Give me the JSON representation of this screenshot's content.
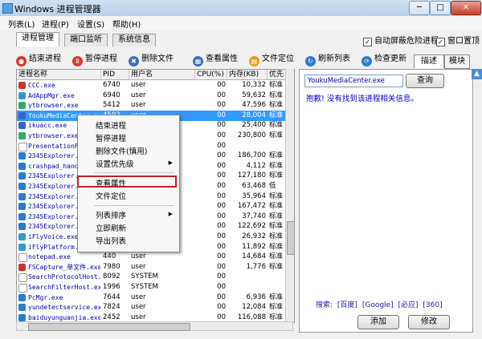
{
  "window": {
    "title": "Windows 进程管理器",
    "min": "─",
    "max": "□",
    "close": "✕"
  },
  "menubar": [
    "列表(L)",
    "进程(P)",
    "设置(S)",
    "帮助(H)"
  ],
  "tabs": [
    "进程管理",
    "端口监听",
    "系统信息"
  ],
  "options": {
    "auto_block": "自动屏蔽危险进程",
    "on_top": "窗口置顶",
    "auto_block_checked": true,
    "on_top_checked": true,
    "check_mark": "✓"
  },
  "toolbar": [
    {
      "label": "结束进程",
      "icon": "end-process-icon",
      "color": "#d93a2a",
      "glyph": "●"
    },
    {
      "label": "暂停进程",
      "icon": "pause-process-icon",
      "color": "#d93a2a",
      "glyph": "Ⅱ"
    },
    {
      "label": "删除文件",
      "icon": "delete-file-icon",
      "color": "#3a6fc0",
      "glyph": "✖"
    },
    {
      "label": "查看属性",
      "icon": "properties-icon",
      "color": "#3a6fc0",
      "glyph": "▦"
    },
    {
      "label": "文件定位",
      "icon": "locate-folder-icon",
      "color": "#e0a020",
      "glyph": "▤"
    },
    {
      "label": "刷新列表",
      "icon": "refresh-icon",
      "color": "#2a7ad0",
      "glyph": "↻"
    },
    {
      "label": "检查更新",
      "icon": "check-update-icon",
      "color": "#2a7ad0",
      "glyph": "⟳"
    }
  ],
  "right_tabs": [
    "描述",
    "模块"
  ],
  "columns": [
    "进程名称",
    "PID",
    "用户名",
    "CPU(%)",
    "内存(KB)",
    "优先"
  ],
  "rows": [
    {
      "name": "CCC.exe",
      "pid": "6740",
      "user": "user",
      "cpu": "00",
      "mem": "10,332",
      "pri": "标准",
      "icon": "#cc3333"
    },
    {
      "name": "AdAppMgr.exe",
      "pid": "6940",
      "user": "user",
      "cpu": "00",
      "mem": "59,632",
      "pri": "标准",
      "icon": "#3399cc"
    },
    {
      "name": "ytbrowser.exe",
      "pid": "5412",
      "user": "user",
      "cpu": "00",
      "mem": "47,596",
      "pri": "标准",
      "icon": "#33aa66"
    },
    {
      "name": "YoukuMediaCenter.exe",
      "pid": "4592",
      "user": "user",
      "cpu": "00",
      "mem": "28,004",
      "pri": "标准",
      "icon": "#3366cc",
      "selected": true
    },
    {
      "name": "ikuacc.exe",
      "pid": "",
      "user": "",
      "cpu": "00",
      "mem": "25,400",
      "pri": "标准",
      "icon": "#3366cc"
    },
    {
      "name": "ytbrowser.exe",
      "pid": "",
      "user": "",
      "cpu": "00",
      "mem": "230,800",
      "pri": "标准",
      "icon": "#33aa66"
    },
    {
      "name": "PresentationFontCache.exe",
      "pid": "",
      "user": "",
      "cpu": "00",
      "mem": "",
      "pri": "",
      "icon": "#ffffff"
    },
    {
      "name": "2345Explorer.exe",
      "pid": "",
      "user": "",
      "cpu": "00",
      "mem": "186,700",
      "pri": "标准",
      "icon": "#2a7ad0"
    },
    {
      "name": "crashpad_handler.exe",
      "pid": "",
      "user": "",
      "cpu": "00",
      "mem": "4,112",
      "pri": "标准",
      "icon": "#2a7ad0"
    },
    {
      "name": "2345Explorer.exe",
      "pid": "",
      "user": "",
      "cpu": "00",
      "mem": "127,180",
      "pri": "标准",
      "icon": "#2a7ad0"
    },
    {
      "name": "2345Explorer.exe",
      "pid": "",
      "user": "",
      "cpu": "00",
      "mem": "63,468",
      "pri": "低",
      "icon": "#2a7ad0"
    },
    {
      "name": "2345Explorer.exe",
      "pid": "",
      "user": "",
      "cpu": "00",
      "mem": "35,964",
      "pri": "标准",
      "icon": "#2a7ad0"
    },
    {
      "name": "2345Explorer.exe",
      "pid": "",
      "user": "",
      "cpu": "00",
      "mem": "167,472",
      "pri": "标准",
      "icon": "#2a7ad0"
    },
    {
      "name": "2345Explorer.exe",
      "pid": "",
      "user": "",
      "cpu": "00",
      "mem": "37,740",
      "pri": "标准",
      "icon": "#2a7ad0"
    },
    {
      "name": "2345Explorer.exe",
      "pid": "",
      "user": "",
      "cpu": "00",
      "mem": "122,692",
      "pri": "标准",
      "icon": "#2a7ad0"
    },
    {
      "name": "iFlyVoice.exe",
      "pid": "",
      "user": "",
      "cpu": "00",
      "mem": "26,932",
      "pri": "标准",
      "icon": "#3399cc"
    },
    {
      "name": "iFlyPlatform.exe",
      "pid": "",
      "user": "",
      "cpu": "00",
      "mem": "11,892",
      "pri": "标准",
      "icon": "#3399cc"
    },
    {
      "name": "notepad.exe",
      "pid": "440",
      "user": "user",
      "cpu": "00",
      "mem": "14,684",
      "pri": "标准",
      "icon": "#ffffff"
    },
    {
      "name": "FSCapture_单文件.exe",
      "pid": "7980",
      "user": "user",
      "cpu": "00",
      "mem": "1,776",
      "pri": "标准",
      "icon": "#cc3333"
    },
    {
      "name": "SearchProtocolHost.exe",
      "pid": "8092",
      "user": "SYSTEM",
      "cpu": "00",
      "mem": "",
      "pri": "",
      "icon": "#ffffff"
    },
    {
      "name": "SearchFilterHost.exe",
      "pid": "1996",
      "user": "SYSTEM",
      "cpu": "00",
      "mem": "",
      "pri": "",
      "icon": "#ffffff"
    },
    {
      "name": "PcMgr.exe",
      "pid": "7644",
      "user": "user",
      "cpu": "00",
      "mem": "6,936",
      "pri": "标准",
      "icon": "#2a7ad0"
    },
    {
      "name": "yundetectservice.exe",
      "pid": "7824",
      "user": "user",
      "cpu": "00",
      "mem": "12,084",
      "pri": "标准",
      "icon": "#2a7ad0"
    },
    {
      "name": "baiduyunguanjia.exe",
      "pid": "2452",
      "user": "user",
      "cpu": "00",
      "mem": "116,088",
      "pri": "标准",
      "icon": "#2a7ad0"
    }
  ],
  "context_menu": [
    {
      "label": "结束进程"
    },
    {
      "label": "暂停进程"
    },
    {
      "label": "删除文件(慎用)"
    },
    {
      "label": "设置优先级",
      "arrow": "▶"
    },
    {
      "label": "查看属性"
    },
    {
      "label": "文件定位"
    },
    {
      "label": "列表排序",
      "arrow": "▶"
    },
    {
      "label": "立即刷新"
    },
    {
      "label": "导出列表"
    }
  ],
  "right_panel": {
    "process_name": "YoukuMediaCenter.exe",
    "query_button": "查询",
    "message": "抱歉! 没有找到该进程相关信息。",
    "search_prefix": "搜索:",
    "search_links": [
      "[百度]",
      "[Google]",
      "[必应]",
      "[360]"
    ],
    "add_button": "添加",
    "edit_button": "修改",
    "ad_glyph": "▲"
  }
}
